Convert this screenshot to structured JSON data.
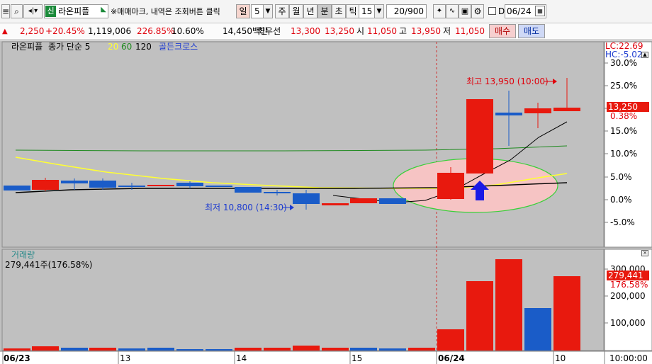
{
  "toolbar": {
    "shin_label": "신",
    "stock_name": "라온피플",
    "hint": "※매매마크, 내역은 조회버튼 클릭",
    "period_day": "일",
    "day_value": "5",
    "period_week": "주",
    "period_month": "월",
    "period_year": "년",
    "period_minute": "분",
    "period_second": "초",
    "period_tick": "틱",
    "interval_value": "15",
    "count_value": "20/900",
    "d_label": "D",
    "date_value": "06/24"
  },
  "quote": {
    "arrow": "▲",
    "change": "2,250",
    "change_pct": "+20.45%",
    "volume": "1,119,006",
    "volume_ratio": "226.85%",
    "turnover": "10.60%",
    "amount": "14,450백만",
    "best_ask_label": "최우선",
    "best_ask": "13,300",
    "best_bid": "13,250",
    "open_label": "시",
    "open": "11,050",
    "high_label": "고",
    "high": "13,950",
    "low_label": "저",
    "low": "11,050",
    "buy_label": "매수",
    "sell_label": "매도"
  },
  "price_panel": {
    "legend_name": "라온피플",
    "legend_ma": "종가 단순 5",
    "legend_20": "20",
    "legend_60": "60",
    "legend_120": "120",
    "legend_signal": "골든크로스",
    "lc": "LC:22.69",
    "hc": "HC:-5.02",
    "high_annotation": "최고 13,950 (10:00)",
    "low_annotation": "최저 10,800 (14:30)",
    "current_price": "13,250",
    "current_pct": "0.38%",
    "pct_ticks": [
      "30.0%",
      "25.0%",
      "20.0%",
      "15.0%",
      "10.0%",
      "5.0%",
      "0.0%",
      "-5.0%"
    ]
  },
  "volume_panel": {
    "title": "거래량",
    "info": "279,441주(176.58%)",
    "current_volume": "279,441",
    "current_pct": "176.58%",
    "ticks": [
      "300,000",
      "200,000",
      "100,000"
    ]
  },
  "x_axis": {
    "labels": [
      "06/23",
      "13",
      "14",
      "15",
      "06/24",
      "10"
    ],
    "time_corner": "10:00:00"
  },
  "colors": {
    "up": "#e8190e",
    "down": "#1a5cc8",
    "ma5": "#000000",
    "ma20": "#ffff33",
    "ma60": "#1f8a1f",
    "ellipse_fill": "#f6c4c4",
    "ellipse_stroke": "#38d038"
  }
}
